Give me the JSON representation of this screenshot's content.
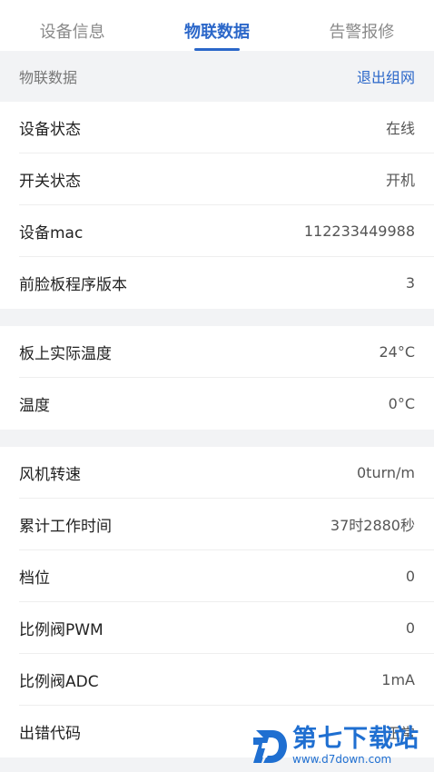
{
  "tabs": [
    {
      "label": "设备信息",
      "active": false
    },
    {
      "label": "物联数据",
      "active": true
    },
    {
      "label": "告警报修",
      "active": false
    }
  ],
  "section": {
    "title": "物联数据",
    "action": "退出组网"
  },
  "group1": [
    {
      "label": "设备状态",
      "value": "在线"
    },
    {
      "label": "开关状态",
      "value": "开机"
    },
    {
      "label": "设备mac",
      "value": "112233449988"
    },
    {
      "label": "前脸板程序版本",
      "value": "3"
    }
  ],
  "group2": [
    {
      "label": "板上实际温度",
      "value": "24°C"
    },
    {
      "label": "温度",
      "value": "0°C"
    }
  ],
  "group3": [
    {
      "label": "风机转速",
      "value": "0turn/m"
    },
    {
      "label": "累计工作时间",
      "value": "37时2880秒"
    },
    {
      "label": "档位",
      "value": "0"
    },
    {
      "label": "比例阀PWM",
      "value": "0"
    },
    {
      "label": "比例阀ADC",
      "value": "1mA"
    },
    {
      "label": "出错代码",
      "value": "正常"
    }
  ],
  "watermark": {
    "name": "第七下载站",
    "url": "www.d7down.com"
  },
  "colors": {
    "accent": "#2b67c9",
    "background": "#f2f3f5",
    "watermark": "#1f6fd1"
  }
}
